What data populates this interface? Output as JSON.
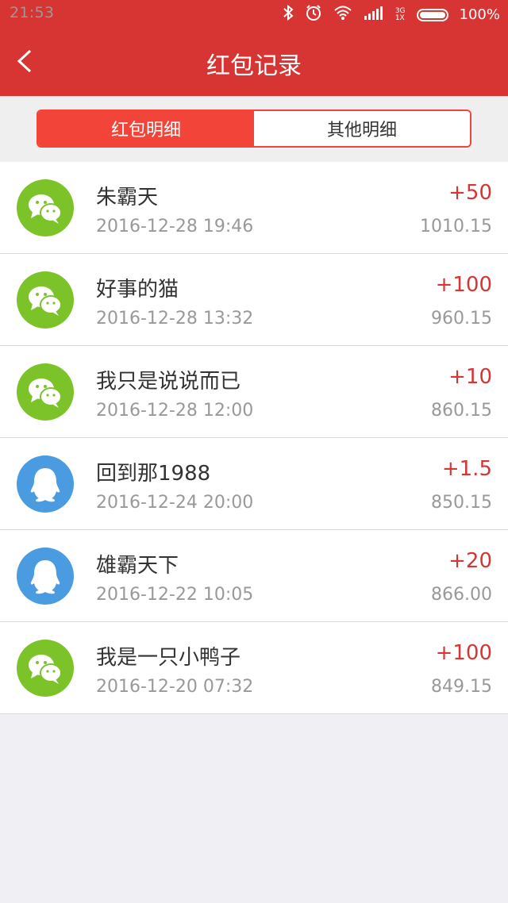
{
  "status_bar": {
    "time": "21:53",
    "network_top": "3G",
    "network_bottom": "1X",
    "battery": "100%"
  },
  "header": {
    "title": "红包记录",
    "back_icon": "chevron-left-icon"
  },
  "tabs": [
    {
      "label": "红包明细",
      "active": true
    },
    {
      "label": "其他明细",
      "active": false
    }
  ],
  "records": [
    {
      "avatar": "wechat-icon",
      "avatar_color": "#7CC32A",
      "name": "朱霸天",
      "time": "2016-12-28 19:46",
      "amount": "+50",
      "balance": "1010.15"
    },
    {
      "avatar": "wechat-icon",
      "avatar_color": "#7CC32A",
      "name": "好事的猫",
      "time": "2016-12-28 13:32",
      "amount": "+100",
      "balance": "960.15"
    },
    {
      "avatar": "wechat-icon",
      "avatar_color": "#7CC32A",
      "name": "我只是说说而已",
      "time": "2016-12-28 12:00",
      "amount": "+10",
      "balance": "860.15"
    },
    {
      "avatar": "qq-icon",
      "avatar_color": "#4A9BE0",
      "name": "回到那1988",
      "time": "2016-12-24 20:00",
      "amount": "+1.5",
      "balance": "850.15"
    },
    {
      "avatar": "qq-icon",
      "avatar_color": "#4A9BE0",
      "name": "雄霸天下",
      "time": "2016-12-22 10:05",
      "amount": "+20",
      "balance": "866.00"
    },
    {
      "avatar": "wechat-icon",
      "avatar_color": "#7CC32A",
      "name": "我是一只小鸭子",
      "time": "2016-12-20 07:32",
      "amount": "+100",
      "balance": "849.15"
    }
  ]
}
